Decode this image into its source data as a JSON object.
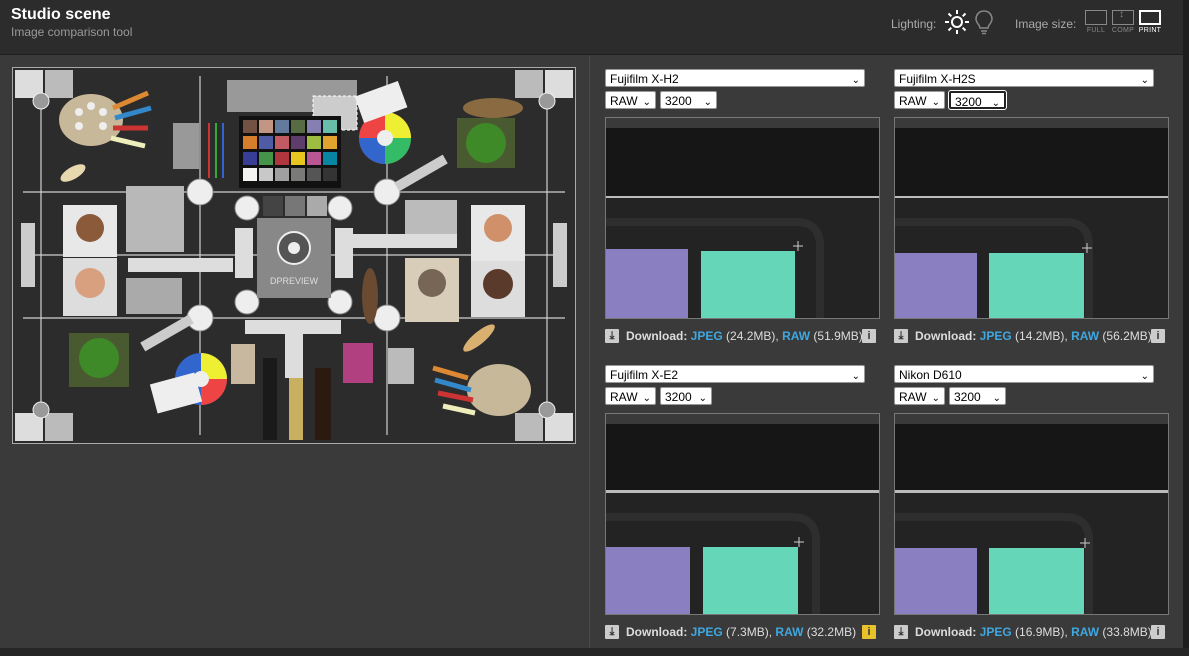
{
  "header": {
    "title": "Studio scene",
    "subtitle": "Image comparison tool",
    "lighting_label": "Lighting:",
    "lighting_options": [
      "sun-icon",
      "bulb-icon"
    ],
    "image_size_label": "Image size:",
    "size_options": [
      {
        "label": "FULL",
        "active": false
      },
      {
        "label": "COMP",
        "active": false
      },
      {
        "label": "PRINT",
        "active": true
      }
    ]
  },
  "scene": {
    "chart_text": "DPREVIEW"
  },
  "panels": [
    {
      "camera": "Fujifilm X-H2",
      "format": "RAW",
      "iso": "3200",
      "download_label": "Download:",
      "jpeg_label": "JPEG",
      "jpeg_size": "(24.2MB)",
      "raw_label": "RAW",
      "raw_size": "(51.9MB)",
      "info_icon": "info-icon",
      "info_state": "normal"
    },
    {
      "camera": "Fujifilm X-H2S",
      "format": "RAW",
      "iso": "3200",
      "download_label": "Download:",
      "jpeg_label": "JPEG",
      "jpeg_size": "(14.2MB)",
      "raw_label": "RAW",
      "raw_size": "(56.2MB)",
      "info_icon": "info-icon",
      "info_state": "normal"
    },
    {
      "camera": "Fujifilm X-E2",
      "format": "RAW",
      "iso": "3200",
      "download_label": "Download:",
      "jpeg_label": "JPEG",
      "jpeg_size": "(7.3MB)",
      "raw_label": "RAW",
      "raw_size": "(32.2MB)",
      "info_icon": "info-icon",
      "info_state": "warning"
    },
    {
      "camera": "Nikon D610",
      "format": "RAW",
      "iso": "3200",
      "download_label": "Download:",
      "jpeg_label": "JPEG",
      "jpeg_size": "(16.9MB)",
      "raw_label": "RAW",
      "raw_size": "(33.8MB)",
      "info_icon": "info-icon",
      "info_state": "normal"
    }
  ],
  "colors": {
    "accent_link": "#3fa8e0",
    "swatch_lavender": "#8a7fc0",
    "swatch_mint": "#66d6b8",
    "warning": "#e8c22a"
  }
}
